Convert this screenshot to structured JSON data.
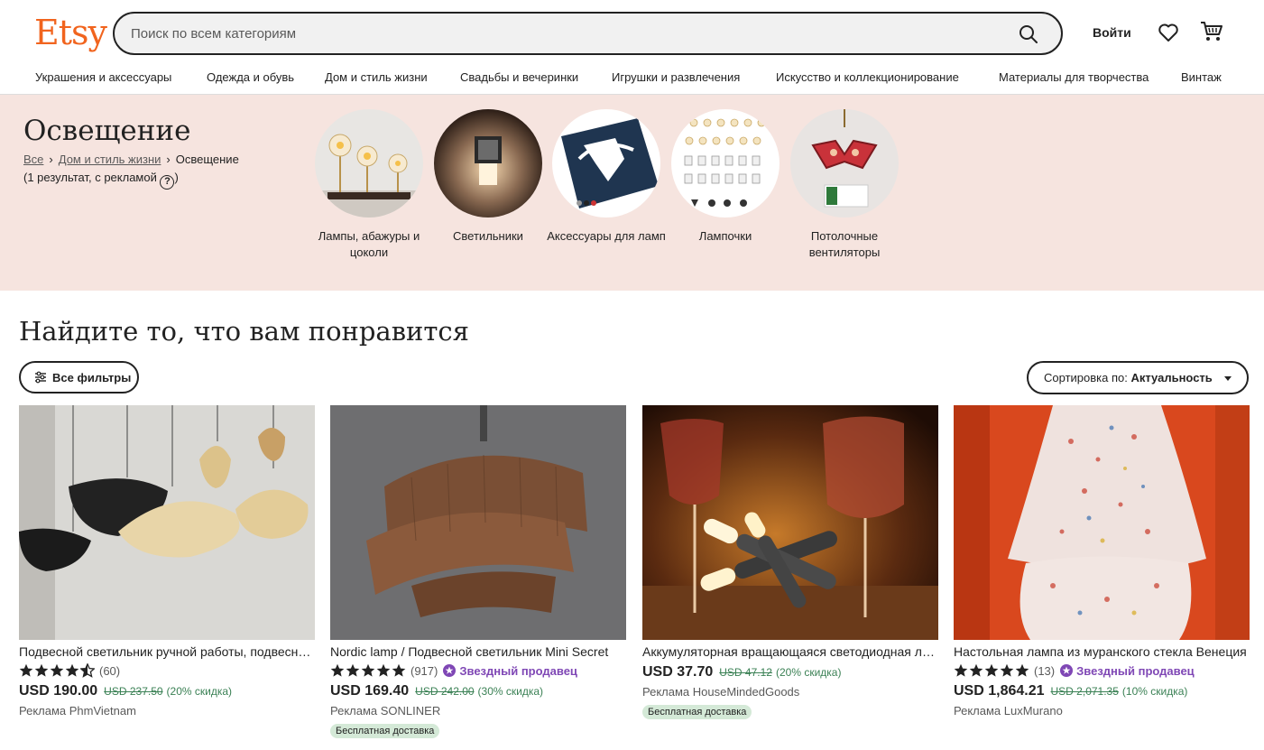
{
  "header": {
    "logo": "Etsy",
    "search_placeholder": "Поиск по всем категориям",
    "login_label": "Войти"
  },
  "nav": {
    "items": [
      "Украшения и аксессуары",
      "Одежда и обувь",
      "Дом и стиль жизни",
      "Свадьбы и вечеринки",
      "Игрушки и развлечения",
      "Искусство и коллекционирование",
      "Материалы для творчества",
      "Винтаж"
    ]
  },
  "category": {
    "title": "Освещение",
    "breadcrumb": [
      "Все",
      "Дом и стиль жизни",
      "Освещение"
    ],
    "results_text": "(1 результат, с рекламой",
    "results_close": ")",
    "subcategories": [
      "Лампы, абажуры и цоколи",
      "Светильники",
      "Аксессуары для ламп",
      "Лампочки",
      "Потолочные вентиляторы"
    ]
  },
  "section": {
    "title": "Найдите то, что вам понравится",
    "filters_label": "Все фильтры",
    "sort_prefix": "Сортировка по: ",
    "sort_value": "Актуальность"
  },
  "products": [
    {
      "title": "Подвесной светильник ручной работы, подвесной светильник",
      "rating": 4.5,
      "reviews": "(60)",
      "star_seller": "",
      "price": "USD 190.00",
      "old_price": "USD 237.50",
      "discount": "(20% скидка)",
      "ad": "Реклама PhmVietnam",
      "badge": ""
    },
    {
      "title": "Nordic lamp / Подвесной светильник Mini Secret",
      "rating": 5,
      "reviews": "(917)",
      "star_seller": "Звездный продавец",
      "price": "USD 169.40",
      "old_price": "USD 242.00",
      "discount": "(30% скидка)",
      "ad": "Реклама SONLINER",
      "badge": "Бесплатная доставка"
    },
    {
      "title": "Аккумуляторная вращающаяся светодиодная лампа",
      "rating": 0,
      "reviews": "",
      "star_seller": "",
      "price": "USD 37.70",
      "old_price": "USD 47.12",
      "discount": "(20% скидка)",
      "ad": "Реклама HouseMindedGoods",
      "badge": "Бесплатная доставка"
    },
    {
      "title": "Настольная лампа из муранского стекла Венеция",
      "rating": 5,
      "reviews": "(13)",
      "star_seller": "Звездный продавец",
      "price": "USD 1,864.21",
      "old_price": "USD 2,071.35",
      "discount": "(10% скидка)",
      "ad": "Реклама LuxMurano",
      "badge": ""
    }
  ],
  "colors": {
    "brand": "#f1641e",
    "band_bg": "#f6e4df",
    "star_seller": "#7f47b5",
    "discount": "#3b8155",
    "free_shipping_bg": "#d4e9d7"
  }
}
